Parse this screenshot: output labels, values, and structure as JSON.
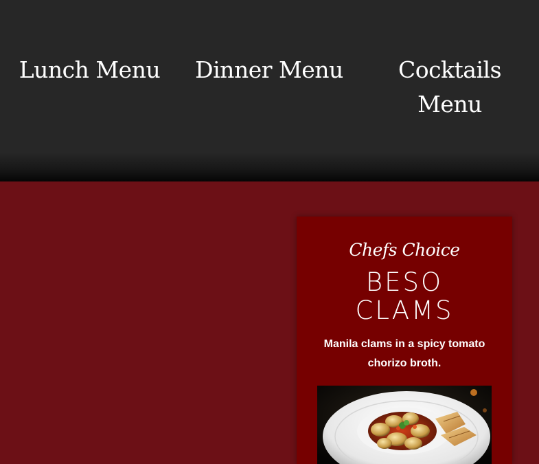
{
  "nav": {
    "lunch_label": "Lunch Menu",
    "dinner_label": "Dinner Menu",
    "cocktails_label": "Cocktails Menu"
  },
  "feature": {
    "kicker": "Chefs Choice",
    "title_line1": "BESO",
    "title_line2": "CLAMS",
    "description": "Manila clams in a spicy tomato chorizo broth.",
    "photo_icon": "clams-dish-photo"
  },
  "colors": {
    "nav_background": "#272727",
    "page_background": "#6c1016",
    "card_background": "#760000",
    "text": "#ffffff"
  }
}
